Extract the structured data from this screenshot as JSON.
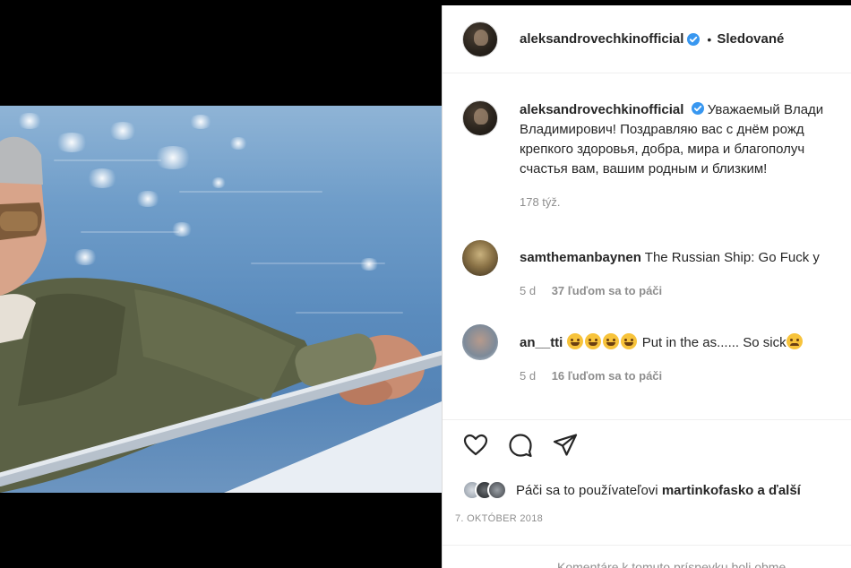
{
  "post": {
    "author": "aleksandrovechkinofficial",
    "separator": "•",
    "follow_status": "Sledované",
    "caption_line1": "Уважаемый Влади",
    "caption_line2": "Владимирович! Поздравляю вас с днём рожд",
    "caption_line3": "крепкого здоровья, добра, мира и благополуч",
    "caption_line4": "счастья вам, вашим родным и близким!",
    "caption_time": "178 týž.",
    "likes_prefix": "Páči sa to používateľovi",
    "likes_user": "martinkofasko",
    "likes_suffix": "a ďalší",
    "date": "7. OKTÓBER 2018",
    "comments_disabled": "Komentáre k tomuto príspevku boli obme"
  },
  "comments": [
    {
      "username": "samthemanbaynen",
      "text": "The Russian Ship: Go Fuck y",
      "time": "5 d",
      "likes": "37 ľuďom sa to páči"
    },
    {
      "username": "an__tti",
      "text_main": "Put in the as...... So sick",
      "time": "5 d",
      "likes": "16 ľuďom sa to páči"
    }
  ],
  "icons": {
    "verified": "verified-badge-icon",
    "like": "heart-icon",
    "comment": "comment-bubble-icon",
    "share": "paper-plane-icon",
    "emoji_laugh": "rolling-laughing-emoji",
    "emoji_joy": "grinning-sweat-emoji",
    "emoji_sad": "disappointed-emoji"
  },
  "colors": {
    "verified_blue": "#3897f0",
    "text_primary": "#262626",
    "text_secondary": "#8e8e8e"
  }
}
